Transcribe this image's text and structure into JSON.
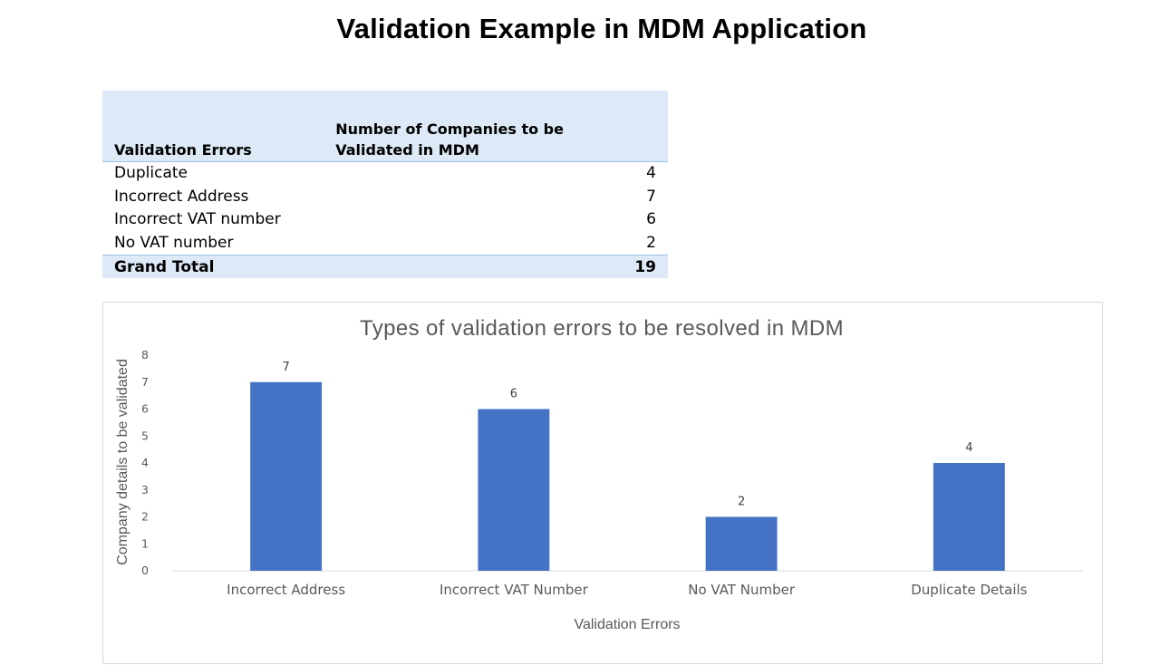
{
  "slide": {
    "title": "Validation Example in MDM Application"
  },
  "pivot_table": {
    "headers": [
      "Validation Errors",
      "Number of Companies to be Validated in MDM"
    ],
    "rows": [
      {
        "label": "Duplicate",
        "count": "4"
      },
      {
        "label": "Incorrect Address",
        "count": "7"
      },
      {
        "label": "Incorrect VAT number",
        "count": "6"
      },
      {
        "label": "No VAT number",
        "count": "2"
      }
    ],
    "total": {
      "label": "Grand Total",
      "count": "19"
    }
  },
  "chart_data": {
    "type": "bar",
    "title": "Types of validation errors to be resolved in MDM",
    "xlabel": "Validation Errors",
    "ylabel": "Company details to be validated",
    "categories": [
      "Incorrect Address",
      "Incorrect VAT Number",
      "No VAT Number",
      "Duplicate Details"
    ],
    "values": [
      7,
      6,
      2,
      4
    ],
    "ylim": [
      0,
      8
    ],
    "ytick_step": 1,
    "grid": false,
    "data_labels": true,
    "bar_color": "#4472c4",
    "axis_color": "#d9d9d9"
  }
}
